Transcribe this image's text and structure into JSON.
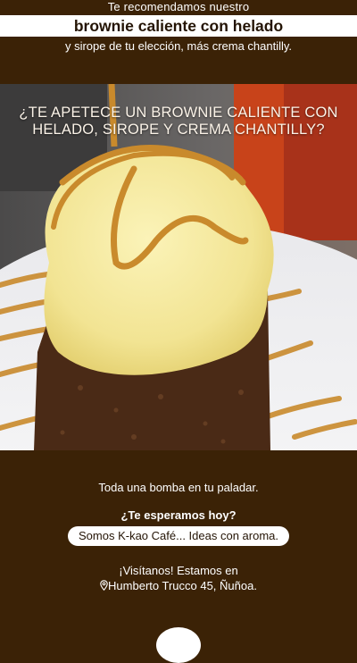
{
  "header": {
    "intro": "Te recomendamos nuestro",
    "headline": "brownie caliente con helado",
    "subline": "y sirope de tu elección, más crema chantilly."
  },
  "photo": {
    "overlay_line1": "¿TE APETECE UN BROWNIE CALIENTE CON",
    "overlay_line2": "HELADO, SIROPE Y CREMA CHANTILLY?"
  },
  "footer": {
    "tagline": "Toda una bomba en tu paladar.",
    "question": "¿Te esperamos hoy?",
    "brand": "Somos K-kao Café... Ideas con aroma.",
    "visit": "¡Visítanos! Estamos en",
    "address": "Humberto Trucco 45, Ñuñoa."
  },
  "colors": {
    "background": "#3b2206",
    "accent": "#ffffff",
    "text_dark": "#241405",
    "caramel": "#c98a2c"
  },
  "icons": {
    "location": "location-pin-icon"
  }
}
